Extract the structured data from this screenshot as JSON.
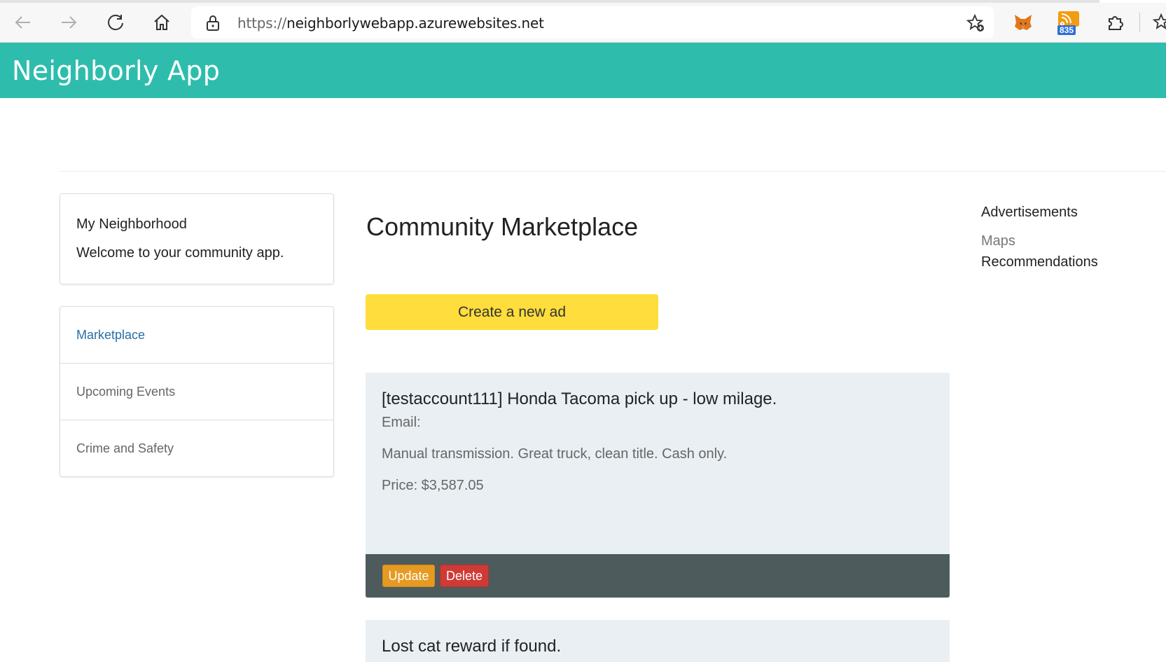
{
  "browser": {
    "url_protocol": "https://",
    "url_host": "neighborlywebapp.azurewebsites.net",
    "rss_count": "835"
  },
  "header": {
    "title": "Neighborly App"
  },
  "sidebar": {
    "card_heading": "My Neighborhood",
    "card_text": "Welcome to your community app.",
    "items": [
      {
        "label": "Marketplace",
        "active": true
      },
      {
        "label": "Upcoming Events",
        "active": false
      },
      {
        "label": "Crime and Safety",
        "active": false
      }
    ]
  },
  "main": {
    "title": "Community Marketplace",
    "create_button": "Create a new ad",
    "ads": [
      {
        "title": "[testaccount111] Honda Tacoma pick up - low milage.",
        "email": "Email:",
        "description": "Manual transmission. Great truck, clean title. Cash only.",
        "price": "Price: $3,587.05",
        "update_label": "Update",
        "delete_label": "Delete"
      },
      {
        "title": "Lost cat reward if found."
      }
    ]
  },
  "right": {
    "heading": "Advertisements",
    "link1": "Maps",
    "link2": "Recommendations"
  },
  "colors": {
    "header_teal": "#2ebdac",
    "create_yellow": "#ffdd3c",
    "update_orange": "#e69a22",
    "delete_red": "#cf3a35",
    "ad_footer": "#4d5b5c"
  }
}
